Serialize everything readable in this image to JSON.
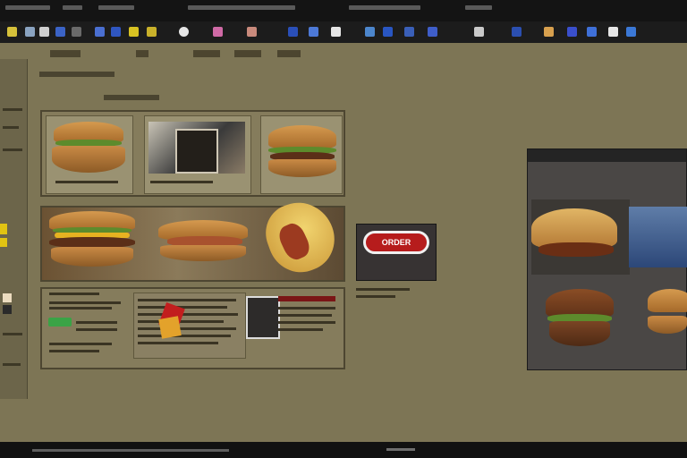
{
  "colors": {
    "frame_dark": "#141414",
    "toolbar_dark": "#1c1c1c",
    "content_bg": "#7d7555",
    "panel_border": "#4d4631",
    "cta_red": "#b61c1c",
    "accent_green": "#3aa346",
    "accent_yellow": "#e1c312"
  },
  "toolbar": {
    "icons": [
      "folder-icon",
      "file-icon",
      "edit-icon",
      "window-icon",
      "link-icon",
      "tool-icon",
      "star-icon",
      "gear-icon",
      "image-icon",
      "heart-icon",
      "globe-icon",
      "book-icon",
      "print-icon",
      "mail-icon",
      "cloud-icon",
      "chart-icon",
      "help-icon",
      "settings-icon",
      "user-icon",
      "search-icon"
    ]
  },
  "cta": {
    "label": "ORDER"
  },
  "status": {
    "text": ""
  }
}
